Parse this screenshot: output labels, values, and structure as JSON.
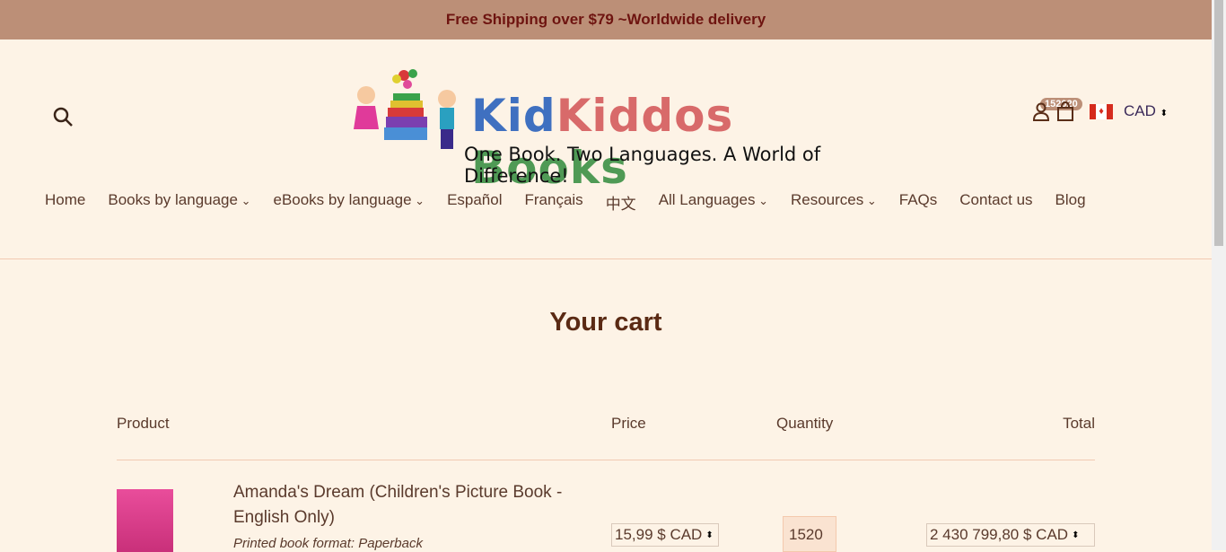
{
  "announcement": "Free Shipping over $79 ~Worldwide delivery",
  "logo": {
    "part1": "Kid",
    "part2": "Kiddos",
    "part3": "Books",
    "tagline": "One Book. Two Languages. A World of Difference!"
  },
  "header": {
    "cart_count": "152020",
    "currency": "CAD"
  },
  "nav": [
    "Home",
    "Books by language",
    "eBooks by language",
    "Español",
    "Français",
    "中文",
    "All Languages",
    "Resources",
    "FAQs",
    "Contact us",
    "Blog"
  ],
  "nav_dropdown": [
    false,
    true,
    true,
    false,
    false,
    false,
    true,
    true,
    false,
    false,
    false
  ],
  "cart": {
    "title": "Your cart",
    "headers": {
      "product": "Product",
      "price": "Price",
      "quantity": "Quantity",
      "total": "Total"
    },
    "items": [
      {
        "name": "Amanda's Dream (Children's Picture Book - English Only)",
        "format": "Printed book format: Paperback",
        "price": "15,99 $ CAD",
        "quantity": "1520",
        "total": "2 430 799,80 $ CAD"
      }
    ]
  },
  "colors": {
    "banner": "#bc8f77",
    "background": "#fdf3e6"
  }
}
